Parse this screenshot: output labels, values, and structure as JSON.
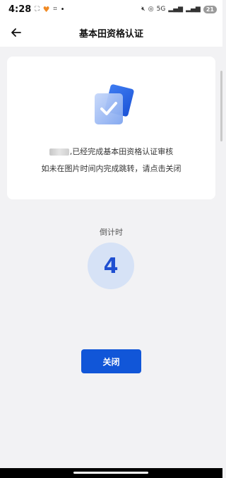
{
  "status_bar": {
    "time": "4:28",
    "signal_text": "5G",
    "battery": "21"
  },
  "header": {
    "title": "基本田资格认证"
  },
  "card": {
    "message_line1": ",已经完成基本田资格认证审核",
    "message_line2": "如未在图片时间内完成跳转，请点击关闭"
  },
  "countdown": {
    "label": "倒计时",
    "value": "4"
  },
  "actions": {
    "close_label": "关闭"
  },
  "colors": {
    "primary": "#1156d8",
    "countdown_bg": "#d6e2f6",
    "countdown_text": "#1f4fd1",
    "page_bg": "#f2f2f4"
  }
}
